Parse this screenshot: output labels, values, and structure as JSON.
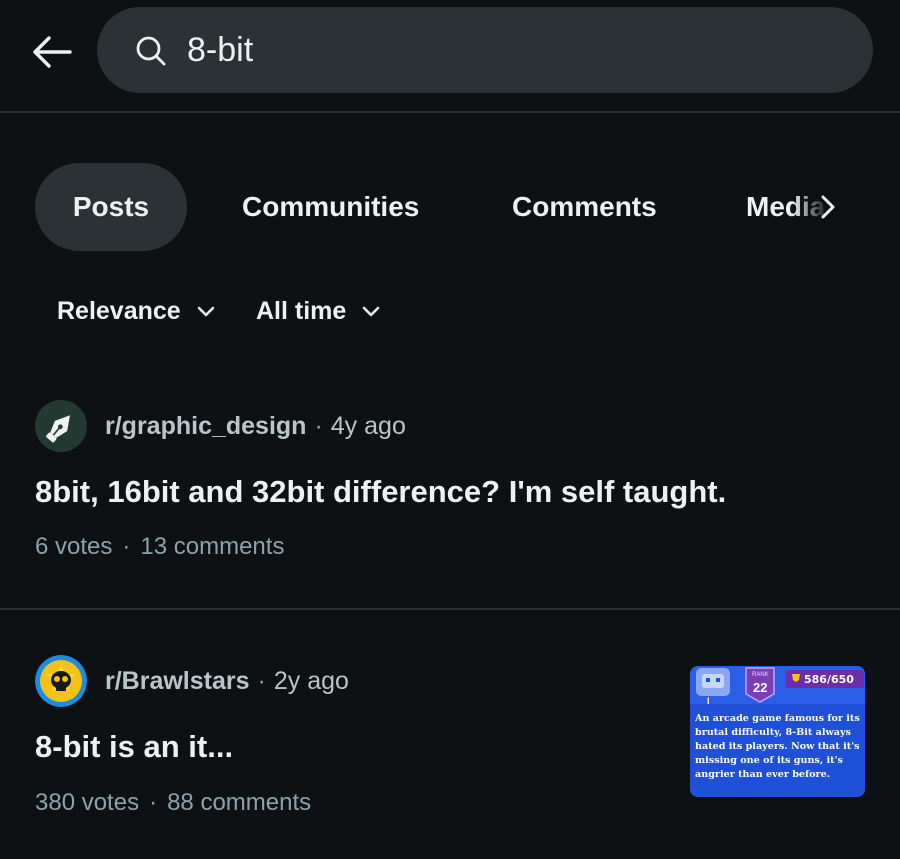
{
  "search": {
    "query": "8-bit"
  },
  "tabs": [
    {
      "label": "Posts"
    },
    {
      "label": "Communities"
    },
    {
      "label": "Comments"
    },
    {
      "label": "Media"
    }
  ],
  "filters": {
    "sort": "Relevance",
    "time": "All time"
  },
  "posts": [
    {
      "subreddit": "r/graphic_design",
      "age": "4y ago",
      "title": "8bit, 16bit and 32bit difference? I'm self taught.",
      "votes": "6 votes",
      "comments": "13 comments",
      "avatar_icon": "pen-nib-icon"
    },
    {
      "subreddit": "r/Brawlstars",
      "age": "2y ago",
      "title": "8-bit is an it...",
      "votes": "380 votes",
      "comments": "88 comments",
      "avatar_icon": "brawl-stars-skull-icon",
      "thumbnail": {
        "rank_label": "RANK",
        "rank": "22",
        "trophies": "586/650",
        "description": "An arcade game famous for its brutal difficulty, 8-Bit always hated its players. Now that it's missing one of its guns, it's angrier than ever before."
      }
    }
  ],
  "colors": {
    "background": "#0e1113",
    "surface": "#2a3236",
    "text_primary": "#eef1f3",
    "text_secondary": "#8ba2ad",
    "thumbnail_blue": "#2050d8",
    "thumbnail_purple": "#7a3fb8"
  }
}
